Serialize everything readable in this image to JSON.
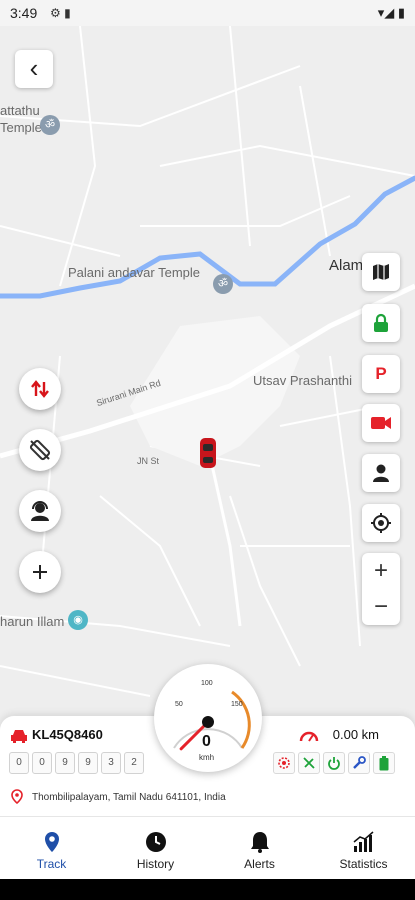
{
  "status_bar": {
    "time": "3:49",
    "left_icons": "⚙ ▮",
    "right_icons": "▾◢ ▮"
  },
  "map": {
    "labels": {
      "attathu": "attathu",
      "temple": "Temple",
      "palani": "Palani andavar Temple",
      "alam": "Alam",
      "utsav": "Utsav Prashanthi",
      "road": "Sirurani Main Rd",
      "jn": "JN St",
      "illam": "harun Illam"
    },
    "colors": {
      "river": "#8ab4f8",
      "road": "#ffffff",
      "land": "#eeeeee"
    }
  },
  "buttons": {
    "back_icon": "‹",
    "zoom_in": "+",
    "zoom_out": "−",
    "parking_label": "P"
  },
  "vehicle": {
    "plate": "KL45Q8460",
    "odometer": [
      "0",
      "0",
      "9",
      "9",
      "3",
      "2"
    ],
    "distance": "0.00 km",
    "address": "Thombilipalayam, Tamil Nadu 641101, India"
  },
  "gauge": {
    "speed": "0",
    "unit": "kmh",
    "ticks": [
      "50",
      "100",
      "150"
    ],
    "max": 180
  },
  "nav": {
    "items": [
      {
        "label": "Track",
        "active": true
      },
      {
        "label": "History",
        "active": false
      },
      {
        "label": "Alerts",
        "active": false
      },
      {
        "label": "Statistics",
        "active": false
      }
    ],
    "active_color": "#1f4fa8"
  }
}
